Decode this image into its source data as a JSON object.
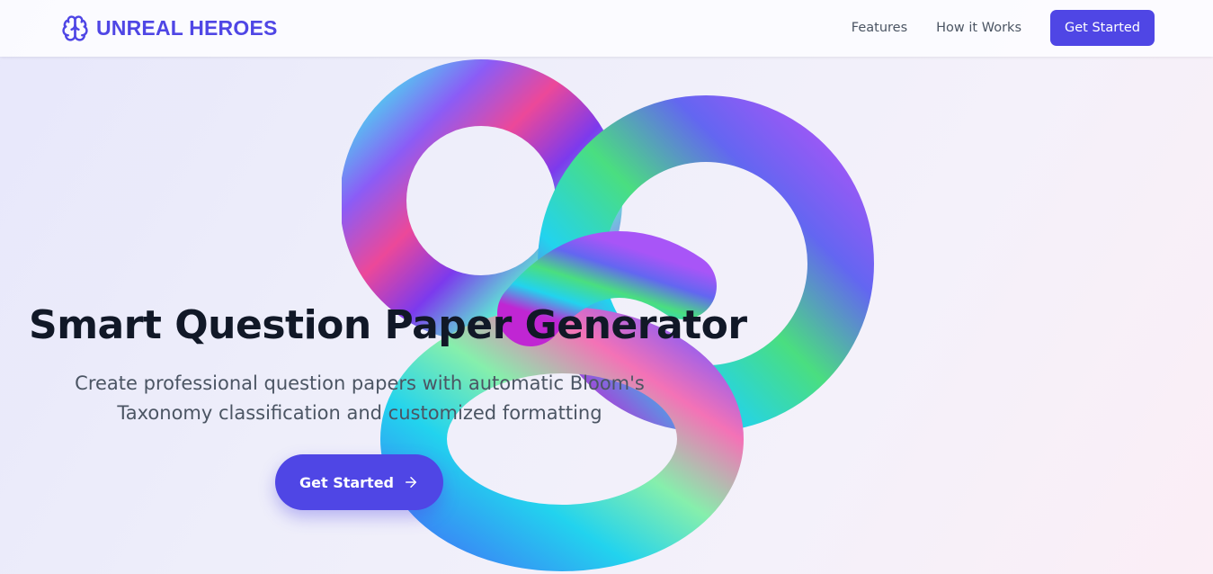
{
  "brand": {
    "name": "UNREAL HEROES",
    "icon": "brain-icon"
  },
  "nav": {
    "links": [
      "Features",
      "How it Works"
    ],
    "cta": "Get Started"
  },
  "hero": {
    "title": "Smart Question Paper Generator",
    "subtitle": "Create professional question papers with automatic Bloom's Taxonomy classification and customized formatting",
    "cta": "Get Started",
    "cta_icon": "arrow-right-icon",
    "graphic": "trefoil-knot-3d"
  },
  "colors": {
    "accent": "#4f46e5",
    "title": "#111827",
    "subtitle": "#4b5563",
    "nav_text": "#4b5563"
  }
}
